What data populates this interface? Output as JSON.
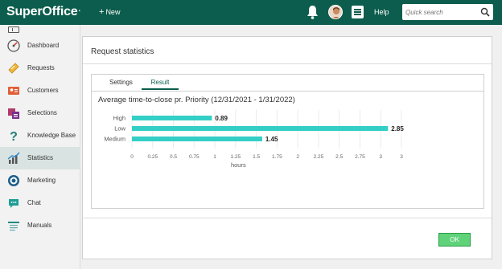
{
  "header": {
    "logo": "SuperOffice",
    "logo_mark": ".",
    "new_label": "New",
    "help_label": "Help",
    "search_placeholder": "Quick search"
  },
  "sidebar": {
    "items": [
      {
        "label": "Dashboard",
        "icon": "dashboard-gauge-icon"
      },
      {
        "label": "Requests",
        "icon": "requests-ticket-icon"
      },
      {
        "label": "Customers",
        "icon": "customers-card-icon"
      },
      {
        "label": "Selections",
        "icon": "selections-icon"
      },
      {
        "label": "Knowledge Base",
        "icon": "question-mark-icon"
      },
      {
        "label": "Statistics",
        "icon": "bar-chart-icon"
      },
      {
        "label": "Marketing",
        "icon": "target-icon"
      },
      {
        "label": "Chat",
        "icon": "chat-bubble-icon"
      },
      {
        "label": "Manuals",
        "icon": "manuals-icon"
      }
    ],
    "active": "Statistics"
  },
  "panel": {
    "title": "Request statistics",
    "tabs": [
      {
        "label": "Settings",
        "active": false
      },
      {
        "label": "Result",
        "active": true
      }
    ],
    "ok_label": "OK"
  },
  "colors": {
    "header_bg": "#0c5d4d",
    "bar": "#33cfc6",
    "ok_button": "#5fd27a"
  },
  "chart_data": {
    "type": "bar",
    "orientation": "horizontal",
    "title": "Average time-to-close pr. Priority (12/31/2021 - 1/31/2022)",
    "categories": [
      "High",
      "Low",
      "Medium"
    ],
    "values": [
      0.89,
      2.85,
      1.45
    ],
    "value_labels": [
      "0.89",
      "2.85",
      "1.45"
    ],
    "xlabel": "hours",
    "xlim": [
      0,
      3
    ],
    "xticks": [
      "0",
      "0.25",
      "0.5",
      "0.75",
      "1",
      "1.25",
      "1.5",
      "1.75",
      "2",
      "2.25",
      "2.5",
      "2.75",
      "3",
      "3"
    ],
    "grid": true
  }
}
